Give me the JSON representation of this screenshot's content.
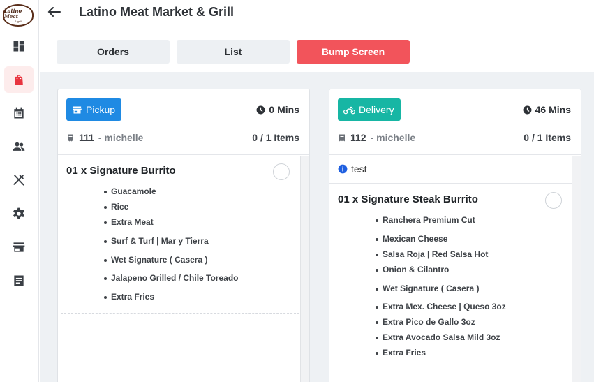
{
  "app": {
    "logo_text": "Latino Meat",
    "title": "Latino Meat Market & Grill"
  },
  "sidebar": {
    "items": [
      {
        "icon": "dashboard-icon",
        "active": false
      },
      {
        "icon": "shopping-bag-icon",
        "active": true
      },
      {
        "icon": "calendar-icon",
        "active": false
      },
      {
        "icon": "people-icon",
        "active": false
      },
      {
        "icon": "utensils-icon",
        "active": false
      },
      {
        "icon": "gear-icon",
        "active": false
      },
      {
        "icon": "store-icon",
        "active": false
      },
      {
        "icon": "document-icon",
        "active": false
      }
    ]
  },
  "tabs": {
    "orders": "Orders",
    "list": "List",
    "bump": "Bump Screen"
  },
  "colors": {
    "accent": "#f2545b",
    "pickup": "#1f8ae3",
    "delivery": "#17b6a4"
  },
  "orders": [
    {
      "type": "Pickup",
      "mins": "0 Mins",
      "number": "111",
      "customer": "- michelle",
      "items_count": "0 / 1 Items",
      "note": "",
      "item_title": "01 x Signature Burrito",
      "modifiers": [
        "Guacamole",
        "Rice",
        "Extra Meat",
        "Surf & Turf | Mar y Tierra",
        "Wet Signature ( Casera )",
        "Jalapeno Grilled / Chile Toreado",
        "Extra Fries"
      ]
    },
    {
      "type": "Delivery",
      "mins": "46 Mins",
      "number": "112",
      "customer": "- michelle",
      "items_count": "0 / 1 Items",
      "note": "test",
      "item_title": "01 x Signature Steak Burrito",
      "modifiers": [
        "Ranchera Premium Cut",
        "Mexican Cheese",
        "Salsa Roja | Red Salsa Hot",
        "Onion & Cilantro",
        "Wet Signature ( Casera )",
        "Extra Mex. Cheese | Queso 3oz",
        "Extra Pico de Gallo 3oz",
        "Extra Avocado Salsa Mild 3oz",
        "Extra Fries"
      ]
    }
  ]
}
